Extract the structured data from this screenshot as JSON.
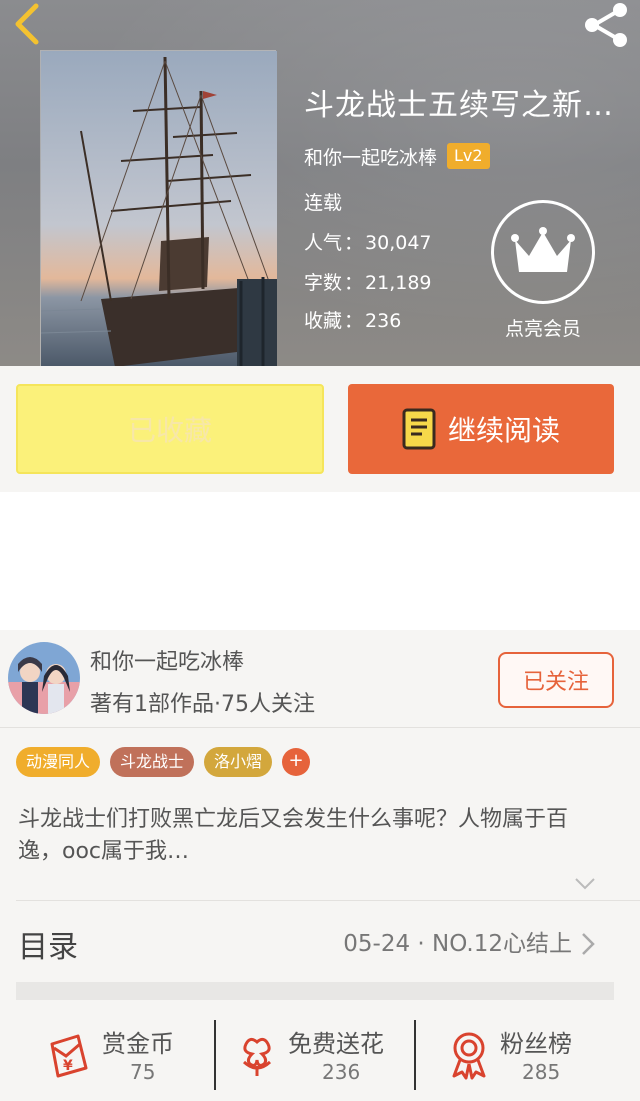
{
  "header": {
    "title": "斗龙战士五续写之新…",
    "author": "和你一起吃冰棒",
    "level": "Lv2",
    "status": "连载",
    "stats": [
      {
        "label": "人气",
        "value": "30,047"
      },
      {
        "label": "字数",
        "value": "21,189"
      },
      {
        "label": "收藏",
        "value": "236"
      }
    ],
    "vip_label": "点亮会员"
  },
  "actions": {
    "favorite_label": "已收藏",
    "read_label": "继续阅读"
  },
  "author_card": {
    "name": "和你一起吃冰棒",
    "meta": "著有1部作品·75人关注",
    "follow_label": "已关注"
  },
  "tags": [
    {
      "label": "动漫同人",
      "color": "#f0ad2c"
    },
    {
      "label": "斗龙战士",
      "color": "#c0715a"
    },
    {
      "label": "洛小熠",
      "color": "#d3a73c"
    }
  ],
  "tag_add_label": "+",
  "description": "斗龙战士们打败黑亡龙后又会发生什么事呢？人物属于百逸，ooc属于我…",
  "toc": {
    "label": "目录",
    "latest": "05-24 · NO.12心结上"
  },
  "bottom": [
    {
      "label": "赏金币",
      "count": "75",
      "icon": "red-envelope-icon"
    },
    {
      "label": "免费送花",
      "count": "236",
      "icon": "flower-icon"
    },
    {
      "label": "粉丝榜",
      "count": "285",
      "icon": "ribbon-award-icon"
    }
  ],
  "colors": {
    "accent": "#e9683a",
    "favorite_bg": "#fbf17a",
    "level_badge": "#f0ad2c"
  }
}
